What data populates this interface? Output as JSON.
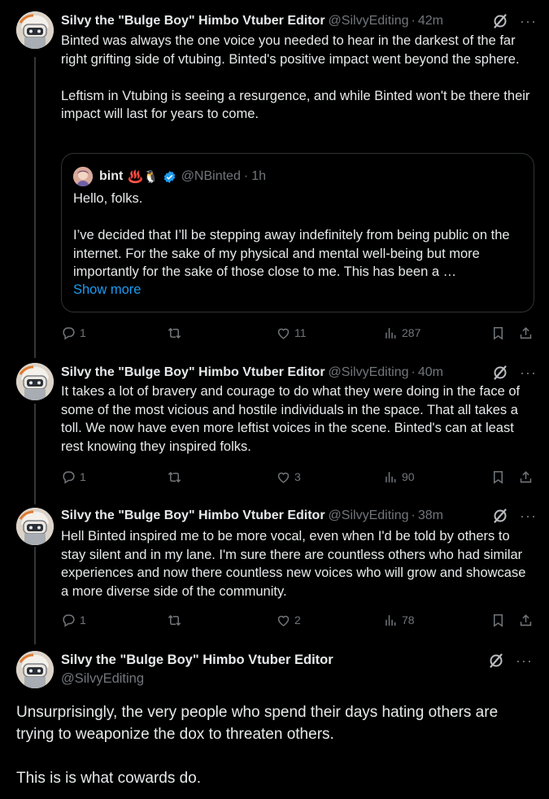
{
  "colors": {
    "background": "#000000",
    "text": "#e7e9ea",
    "muted": "#71767b",
    "link": "#1d9bf0",
    "border": "#2f3336"
  },
  "tweets": [
    {
      "name": "Silvy the \"Bulge Boy\" Himbo Vtuber Editor",
      "handle": "@SilvyEditing",
      "time": "42m",
      "text": "Binted was always the one voice you needed to hear in the darkest of the far right grifting side of vtubing. Binted's positive impact went beyond the sphere.\n\nLeftism in Vtubing is seeing a resurgence, and while Binted won't be there their impact will last for years to come.",
      "quote": {
        "name": "bint",
        "emoji": "♨️🐧",
        "handle": "@NBinted",
        "time": "1h",
        "text": "Hello, folks.\n\nI’ve decided that I’ll be stepping away indefinitely from being public on the internet. For the sake of my physical and mental well-being but more importantly for the sake of those close to me. This has been a …",
        "show_more": "Show more"
      },
      "replies": "1",
      "likes": "11",
      "views": "287"
    },
    {
      "name": "Silvy the \"Bulge Boy\" Himbo Vtuber Editor",
      "handle": "@SilvyEditing",
      "time": "40m",
      "text": "It takes a lot of bravery and courage to do what they were doing in the face of some of the most vicious and hostile individuals in the space. That all takes a toll. We now have even more leftist voices in the scene. Binted's can at least rest knowing they inspired folks.",
      "replies": "1",
      "likes": "3",
      "views": "90"
    },
    {
      "name": "Silvy the \"Bulge Boy\" Himbo Vtuber Editor",
      "handle": "@SilvyEditing",
      "time": "38m",
      "text": "Hell Binted inspired me to be more vocal, even when I'd be told by others to stay silent and in my lane. I'm sure there are countless others who had similar experiences and now there countless new voices who will grow and showcase a more diverse side of the community.",
      "replies": "1",
      "likes": "2",
      "views": "78"
    }
  ],
  "main": {
    "name": "Silvy the \"Bulge Boy\" Himbo Vtuber Editor",
    "handle": "@SilvyEditing",
    "text": "Unsurprisingly, the very people who spend their days hating others are trying to weaponize the dox to threaten others.\n\nThis is is what cowards do."
  },
  "common": {
    "separator": "·",
    "more": "···"
  },
  "icons": [
    "avatar",
    "grok-icon",
    "more-icon",
    "reply-icon",
    "retweet-icon",
    "like-icon",
    "views-icon",
    "bookmark-icon",
    "share-icon",
    "verified-icon"
  ]
}
